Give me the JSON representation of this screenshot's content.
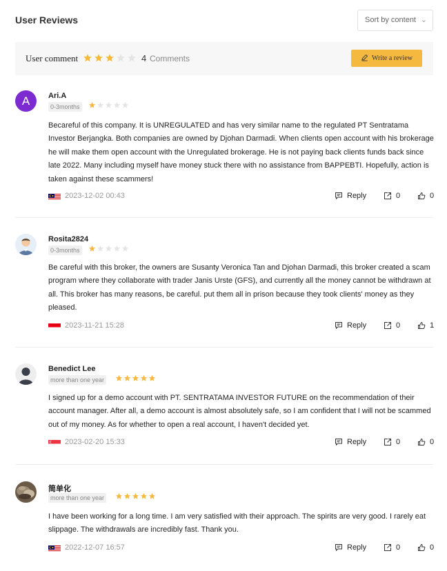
{
  "header": {
    "title": "User Reviews",
    "sort_label": "Sort by content"
  },
  "summary": {
    "label": "User comment",
    "rating": 3,
    "count": "4",
    "count_label": "Comments",
    "write_label": "Write a review"
  },
  "colors": {
    "star_filled": "#f6b940",
    "star_empty": "#e5e5e5",
    "accent": "#f6b940"
  },
  "actions": {
    "reply_label": "Reply"
  },
  "reviews": [
    {
      "name": "Ari.A",
      "avatar_letter": "A",
      "tenure": "0-3months",
      "rating": 1,
      "content": "Becareful of this company. It is UNREGULATED and has very similar name to the regulated PT Sentratama Investor Berjangka. Both companies are owned by Djohan Darmadi. When clients open account with his brokerage he will make them open account with the Unregulated brokerage. He is not paying back clients funds back since late 2022. Many including myself have money stuck there with no assistance from BAPPEBTI. Hopefully, action is taken against these scammers!",
      "flag": "malaysia-flag",
      "date": "2023-12-02 00:43",
      "shares": "0",
      "likes": "0"
    },
    {
      "name": "Rosita2824",
      "tenure": "0-3months",
      "rating": 1,
      "content": "Be careful with this broker, the owners are Susanty Veronica Tan and Djohan Darmadi, this broker created a scam program where they collaborate with trader Janis Urste (GFS), and currently all the money cannot be withdrawn at all. This broker has many reasons, be careful. put them all in prison because they took clients' money as they pleased.",
      "flag": "indonesia-flag",
      "date": "2023-11-21 15:28",
      "shares": "0",
      "likes": "1"
    },
    {
      "name": "Benedict Lee",
      "tenure": "more than one year",
      "rating": 5,
      "content": "I signed up for a demo account with PT. SENTRATAMA INVESTOR FUTURE on the recommendation of their account manager. After all, a demo account is almost absolutely safe, so I am confident that I will not be scammed out of my money. As for whether to open a real account, I haven't decided yet.",
      "flag": "singapore-flag",
      "date": "2023-02-20 15:33",
      "shares": "0",
      "likes": "0"
    },
    {
      "name": "简单化",
      "tenure": "more than one year",
      "rating": 5,
      "content": "I have been working for a long time. I am very satisfied with their approach. The spirits are very good. I rarely eat slippage. The withdrawals are incredibly fast. Thank you.",
      "flag": "malaysia-flag",
      "date": "2022-12-07 16:57",
      "shares": "0",
      "likes": "0"
    }
  ]
}
